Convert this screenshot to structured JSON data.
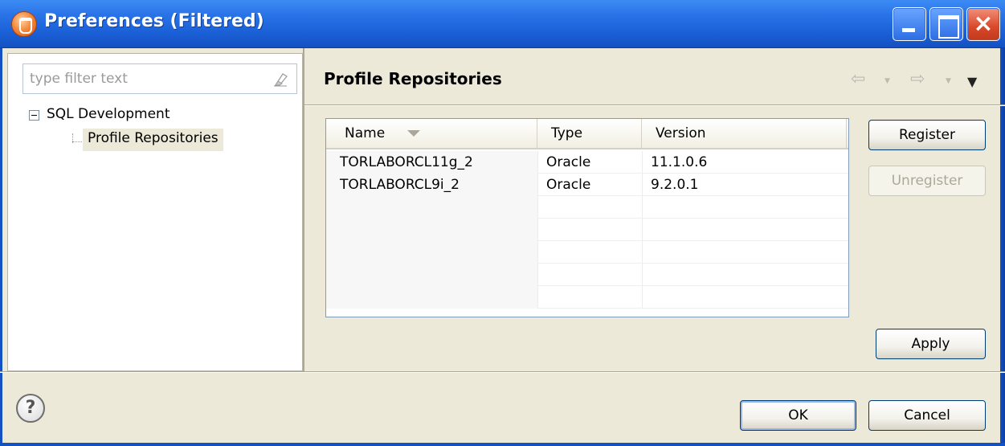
{
  "window": {
    "title": "Preferences (Filtered)",
    "close_glyph": "×"
  },
  "filter": {
    "placeholder": "type filter text",
    "value": ""
  },
  "tree": {
    "root_label": "SQL Development",
    "child_label": "Profile Repositories",
    "selected": "Profile Repositories"
  },
  "page": {
    "title": "Profile Repositories",
    "nav_back_glyph": "⇦",
    "nav_forward_glyph": "⇨",
    "nav_dropdown_glyph": "▼",
    "view_menu_glyph": "▼"
  },
  "table": {
    "columns": [
      "Name",
      "Type",
      "Version"
    ],
    "sort_column": "Name",
    "rows": [
      {
        "name": "TORLABORCL11g_2",
        "type": "Oracle",
        "version": "11.1.0.6"
      },
      {
        "name": "TORLABORCL9i_2",
        "type": "Oracle",
        "version": "9.2.0.1"
      }
    ]
  },
  "buttons": {
    "register": "Register",
    "unregister": "Unregister",
    "apply": "Apply",
    "ok": "OK",
    "cancel": "Cancel"
  },
  "help": {
    "glyph": "?"
  },
  "icons": {
    "app": "preferences-icon",
    "filter_clear": "eraser-icon",
    "help": "help-icon"
  },
  "colors": {
    "titlebar": "#2a74e8",
    "close_button": "#d9482a",
    "dialog_background": "#ece9d8",
    "selection_background": "#ece9d8"
  }
}
